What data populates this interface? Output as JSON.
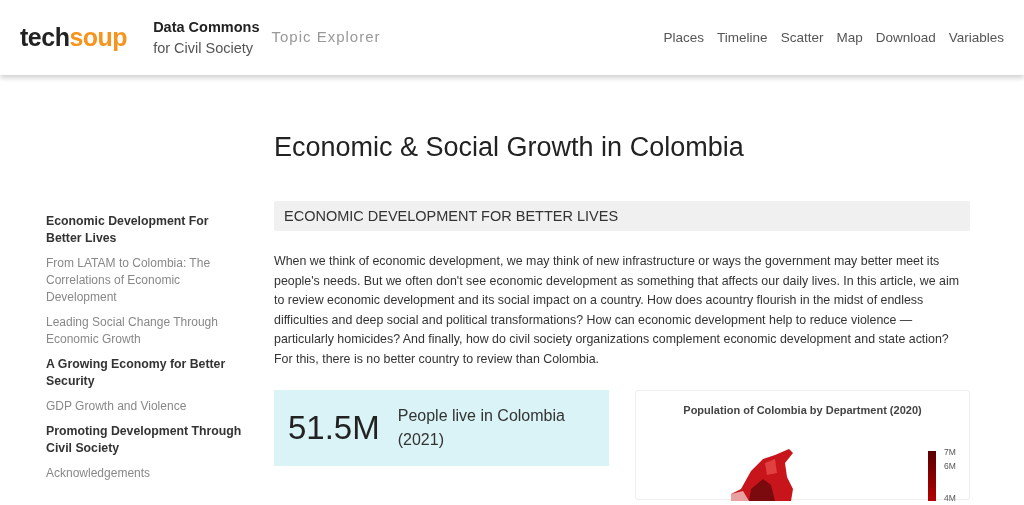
{
  "header": {
    "logo": {
      "dark": "tech",
      "accent": "soup"
    },
    "brand": [
      "Data Commons",
      "for Civil Society"
    ],
    "subtitle": "Topic Explorer",
    "nav": [
      "Places",
      "Timeline",
      "Scatter",
      "Map",
      "Download",
      "Variables"
    ]
  },
  "sidebar": {
    "sections": [
      {
        "title": "Economic Development For Better Lives",
        "children": [
          {
            "title": "From LATAM to Colombia: The Correlations of Economic Development"
          },
          {
            "title": "Leading Social Change Through Economic Growth"
          }
        ]
      },
      {
        "title": "A Growing Economy for Better Security",
        "children": [
          {
            "title": "GDP Growth and Violence"
          }
        ]
      },
      {
        "title": "Promoting Development Through Civil Society",
        "children": [
          {
            "title": "Acknowledgements"
          }
        ]
      }
    ]
  },
  "article": {
    "title": "Economic & Social Growth in Colombia",
    "section_heading": "ECONOMIC DEVELOPMENT FOR BETTER LIVES",
    "paragraph": "When we think of economic development, we may think of new infrastructure or ways the government may better meet its people's needs. But we often don't see economic development as something that affects our daily lives. In this article, we aim to review economic development and its social impact on a country. How does acountry flourish in the midst of endless difficulties and deep social and political transformations? How can economic development help to reduce violence — particularly homicides? And finally, how do civil society organizations complement economic development and state action? For this, there is no better country to review than Colombia.",
    "stat": {
      "value": "51.5M",
      "label": "People live in Colombia (2021)"
    },
    "map": {
      "title": "Population of Colombia by Department (2020)",
      "legend": [
        "7M",
        "6M",
        "4M"
      ]
    }
  }
}
